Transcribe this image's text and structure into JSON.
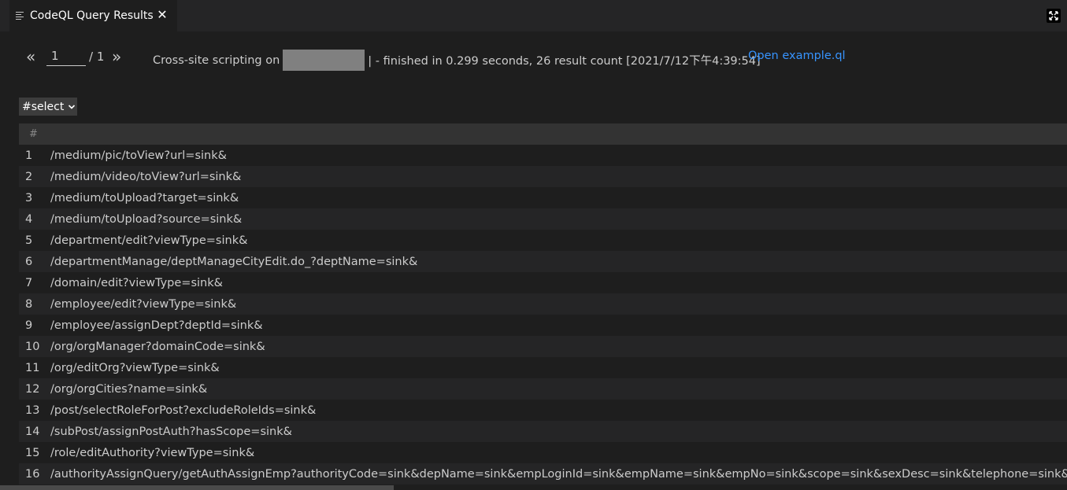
{
  "tab": {
    "title": "CodeQL Query Results",
    "close_glyph": "✕",
    "icon": "list-icon"
  },
  "pager": {
    "prev_glyph": "«",
    "next_glyph": "»",
    "current_page": "1",
    "total": "/ 1"
  },
  "status": {
    "prefix": "Cross-site scripting on",
    "suffix": "| - finished in 0.299 seconds, 26 result count [2021/7/12下午4:39:54]"
  },
  "open_link": "Open example.ql",
  "select": {
    "label": "#select",
    "chevron": "⌄"
  },
  "table": {
    "header": "#",
    "rows": [
      {
        "idx": "1",
        "value": "/medium/pic/toView?url=sink&"
      },
      {
        "idx": "2",
        "value": "/medium/video/toView?url=sink&"
      },
      {
        "idx": "3",
        "value": "/medium/toUpload?target=sink&"
      },
      {
        "idx": "4",
        "value": "/medium/toUpload?source=sink&"
      },
      {
        "idx": "5",
        "value": "/department/edit?viewType=sink&"
      },
      {
        "idx": "6",
        "value": "/departmentManage/deptManageCityEdit.do_?deptName=sink&"
      },
      {
        "idx": "7",
        "value": "/domain/edit?viewType=sink&"
      },
      {
        "idx": "8",
        "value": "/employee/edit?viewType=sink&"
      },
      {
        "idx": "9",
        "value": "/employee/assignDept?deptId=sink&"
      },
      {
        "idx": "10",
        "value": "/org/orgManager?domainCode=sink&"
      },
      {
        "idx": "11",
        "value": "/org/editOrg?viewType=sink&"
      },
      {
        "idx": "12",
        "value": "/org/orgCities?name=sink&"
      },
      {
        "idx": "13",
        "value": "/post/selectRoleForPost?excludeRoleIds=sink&"
      },
      {
        "idx": "14",
        "value": "/subPost/assignPostAuth?hasScope=sink&"
      },
      {
        "idx": "15",
        "value": "/role/editAuthority?viewType=sink&"
      },
      {
        "idx": "16",
        "value": "/authorityAssignQuery/getAuthAssignEmp?authorityCode=sink&depName=sink&empLoginId=sink&empName=sink&empNo=sink&scope=sink&sexDesc=sink&telephone=sink&"
      }
    ]
  },
  "colors": {
    "background": "#1e1e1e",
    "tabbar": "#252526",
    "link": "#3794ff",
    "row_alt": "#252526",
    "header": "#333333"
  }
}
